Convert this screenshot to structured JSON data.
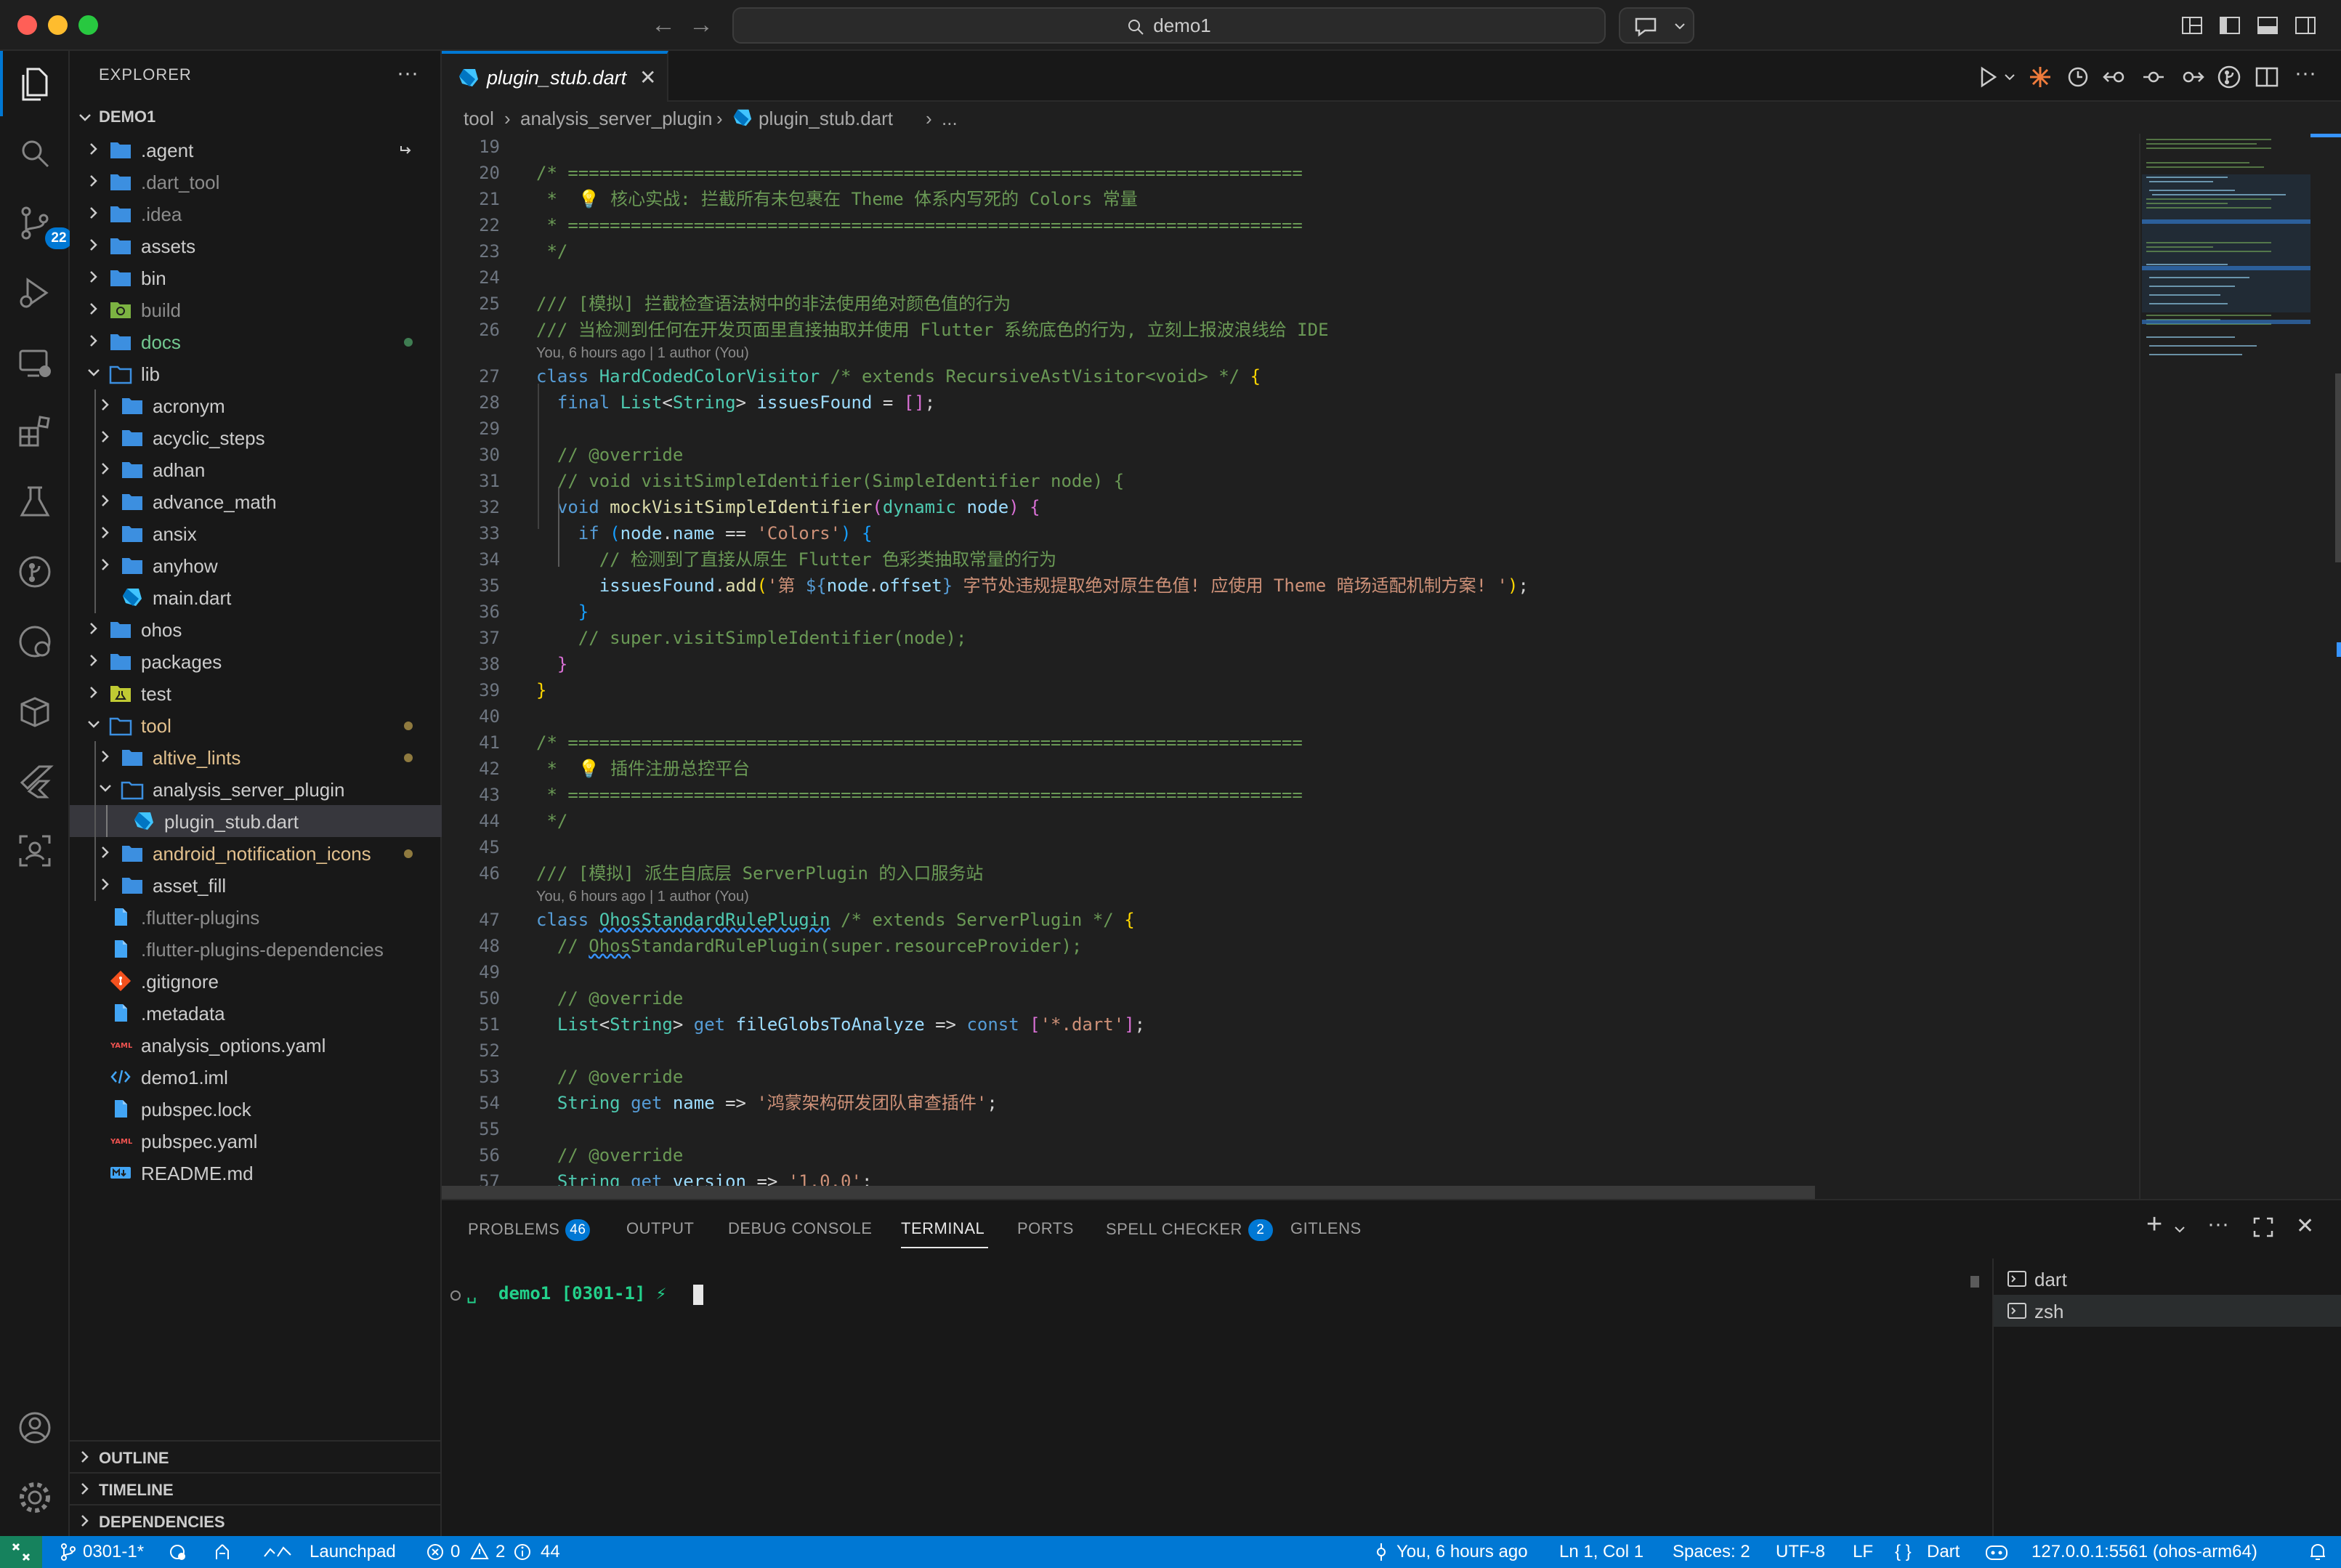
{
  "window": {
    "title": "demo1"
  },
  "sidebar": {
    "title": "EXPLORER",
    "workspace": "DEMO1",
    "tree": [
      {
        "label": ".agent",
        "depth": 0,
        "kind": "folder",
        "open": false,
        "style": "normal",
        "decor": "arrow"
      },
      {
        "label": ".dart_tool",
        "depth": 0,
        "kind": "folder",
        "open": false,
        "style": "dimmed"
      },
      {
        "label": ".idea",
        "depth": 0,
        "kind": "folder",
        "open": false,
        "style": "dimmed"
      },
      {
        "label": "assets",
        "depth": 0,
        "kind": "folder",
        "open": false,
        "style": "normal"
      },
      {
        "label": "bin",
        "depth": 0,
        "kind": "folder",
        "open": false,
        "style": "normal"
      },
      {
        "label": "build",
        "depth": 0,
        "kind": "build-folder",
        "open": false,
        "style": "dimmed"
      },
      {
        "label": "docs",
        "depth": 0,
        "kind": "folder",
        "open": false,
        "style": "green",
        "decor": "dot-green"
      },
      {
        "label": "lib",
        "depth": 0,
        "kind": "folder",
        "open": true,
        "style": "normal"
      },
      {
        "label": "acronym",
        "depth": 1,
        "kind": "folder",
        "open": false,
        "style": "normal"
      },
      {
        "label": "acyclic_steps",
        "depth": 1,
        "kind": "folder",
        "open": false,
        "style": "normal"
      },
      {
        "label": "adhan",
        "depth": 1,
        "kind": "folder",
        "open": false,
        "style": "normal"
      },
      {
        "label": "advance_math",
        "depth": 1,
        "kind": "folder",
        "open": false,
        "style": "normal"
      },
      {
        "label": "ansix",
        "depth": 1,
        "kind": "folder",
        "open": false,
        "style": "normal"
      },
      {
        "label": "anyhow",
        "depth": 1,
        "kind": "folder",
        "open": false,
        "style": "normal"
      },
      {
        "label": "main.dart",
        "depth": 1,
        "kind": "dart",
        "style": "normal"
      },
      {
        "label": "ohos",
        "depth": 0,
        "kind": "folder",
        "open": false,
        "style": "normal"
      },
      {
        "label": "packages",
        "depth": 0,
        "kind": "folder",
        "open": false,
        "style": "normal"
      },
      {
        "label": "test",
        "depth": 0,
        "kind": "test-folder",
        "open": false,
        "style": "normal"
      },
      {
        "label": "tool",
        "depth": 0,
        "kind": "folder",
        "open": true,
        "style": "modified",
        "decor": "dot-yellow"
      },
      {
        "label": "altive_lints",
        "depth": 1,
        "kind": "folder",
        "open": false,
        "style": "modified",
        "decor": "dot-yellow"
      },
      {
        "label": "analysis_server_plugin",
        "depth": 1,
        "kind": "folder",
        "open": true,
        "style": "normal"
      },
      {
        "label": "plugin_stub.dart",
        "depth": 2,
        "kind": "dart",
        "style": "normal",
        "selected": true
      },
      {
        "label": "android_notification_icons",
        "depth": 1,
        "kind": "folder",
        "open": false,
        "style": "modified",
        "decor": "dot-yellow"
      },
      {
        "label": "asset_fill",
        "depth": 1,
        "kind": "folder",
        "open": false,
        "style": "normal"
      },
      {
        "label": ".flutter-plugins",
        "depth": 0,
        "kind": "file",
        "style": "dimmed"
      },
      {
        "label": ".flutter-plugins-dependencies",
        "depth": 0,
        "kind": "file",
        "style": "dimmed"
      },
      {
        "label": ".gitignore",
        "depth": 0,
        "kind": "git",
        "style": "normal"
      },
      {
        "label": ".metadata",
        "depth": 0,
        "kind": "file",
        "style": "normal"
      },
      {
        "label": "analysis_options.yaml",
        "depth": 0,
        "kind": "yaml",
        "style": "normal"
      },
      {
        "label": "demo1.iml",
        "depth": 0,
        "kind": "xml",
        "style": "normal"
      },
      {
        "label": "pubspec.lock",
        "depth": 0,
        "kind": "file",
        "style": "normal"
      },
      {
        "label": "pubspec.yaml",
        "depth": 0,
        "kind": "yaml",
        "style": "normal"
      },
      {
        "label": "README.md",
        "depth": 0,
        "kind": "md",
        "style": "normal"
      }
    ],
    "sections": [
      "OUTLINE",
      "TIMELINE",
      "DEPENDENCIES"
    ]
  },
  "activity": {
    "scm_badge": "22"
  },
  "editor": {
    "tab_title": "plugin_stub.dart",
    "breadcrumb": [
      "tool",
      "analysis_server_plugin",
      "plugin_stub.dart",
      "..."
    ],
    "blame_text": "You, 6 hours ago | 1 author (You)",
    "lines": [
      {
        "n": "19",
        "tokens": []
      },
      {
        "n": "20",
        "tokens": [
          [
            "c-com",
            "/* ======================================================================"
          ]
        ]
      },
      {
        "n": "21",
        "tokens": [
          [
            "c-com",
            " *  💡 核心实战: 拦截所有未包裹在 Theme 体系内写死的 Colors 常量"
          ]
        ]
      },
      {
        "n": "22",
        "tokens": [
          [
            "c-com",
            " * ======================================================================"
          ]
        ]
      },
      {
        "n": "23",
        "tokens": [
          [
            "c-com",
            " */"
          ]
        ]
      },
      {
        "n": "24",
        "tokens": []
      },
      {
        "n": "25",
        "tokens": [
          [
            "c-com",
            "/// [模拟] 拦截检查语法树中的非法使用绝对颜色值的行为"
          ]
        ]
      },
      {
        "n": "26",
        "tokens": [
          [
            "c-com",
            "/// 当检测到任何在开发页面里直接抽取并使用 Flutter 系统底色的行为, 立刻上报波浪线给 IDE"
          ]
        ],
        "blame_after": true
      },
      {
        "n": "27",
        "tokens": [
          [
            "c-kw",
            "class "
          ],
          [
            "c-type",
            "HardCodedColorVisitor"
          ],
          [
            "c-com",
            " /* extends RecursiveAstVisitor<void> */"
          ],
          [
            "c-pun",
            " "
          ],
          [
            "c-br1",
            "{"
          ]
        ]
      },
      {
        "n": "28",
        "tokens": [
          [
            "c-pun",
            "  "
          ],
          [
            "c-kw",
            "final "
          ],
          [
            "c-type",
            "List"
          ],
          [
            "c-pun",
            "<"
          ],
          [
            "c-type",
            "String"
          ],
          [
            "c-pun",
            "> "
          ],
          [
            "c-var",
            "issuesFound"
          ],
          [
            "c-pun",
            " = "
          ],
          [
            "c-br2",
            "[]"
          ],
          [
            "c-pun",
            ";"
          ]
        ]
      },
      {
        "n": "29",
        "tokens": []
      },
      {
        "n": "30",
        "tokens": [
          [
            "c-com",
            "  // @override"
          ]
        ]
      },
      {
        "n": "31",
        "tokens": [
          [
            "c-com",
            "  // void visitSimpleIdentifier(SimpleIdentifier node) {"
          ]
        ]
      },
      {
        "n": "32",
        "tokens": [
          [
            "c-pun",
            "  "
          ],
          [
            "c-kw",
            "void "
          ],
          [
            "c-fn",
            "mockVisitSimpleIdentifier"
          ],
          [
            "c-br2",
            "("
          ],
          [
            "c-type",
            "dynamic "
          ],
          [
            "c-var",
            "node"
          ],
          [
            "c-br2",
            ")"
          ],
          [
            "c-pun",
            " "
          ],
          [
            "c-br2",
            "{"
          ]
        ]
      },
      {
        "n": "33",
        "tokens": [
          [
            "c-pun",
            "    "
          ],
          [
            "c-kw",
            "if "
          ],
          [
            "c-br3",
            "("
          ],
          [
            "c-var",
            "node"
          ],
          [
            "c-pun",
            "."
          ],
          [
            "c-var",
            "name"
          ],
          [
            "c-pun",
            " == "
          ],
          [
            "c-str",
            "'Colors'"
          ],
          [
            "c-br3",
            ")"
          ],
          [
            "c-pun",
            " "
          ],
          [
            "c-br3",
            "{"
          ]
        ]
      },
      {
        "n": "34",
        "tokens": [
          [
            "c-com",
            "      // 检测到了直接从原生 Flutter 色彩类抽取常量的行为"
          ]
        ]
      },
      {
        "n": "35",
        "tokens": [
          [
            "c-pun",
            "      "
          ],
          [
            "c-var",
            "issuesFound"
          ],
          [
            "c-pun",
            "."
          ],
          [
            "c-fn",
            "add"
          ],
          [
            "c-br1",
            "("
          ],
          [
            "c-str",
            "'第 "
          ],
          [
            "c-kw",
            "${"
          ],
          [
            "c-var",
            "node"
          ],
          [
            "c-pun",
            "."
          ],
          [
            "c-var",
            "offset"
          ],
          [
            "c-kw",
            "}"
          ],
          [
            "c-str",
            " 字节处违规提取绝对原生色值! 应使用 Theme 暗场适配机制方案! '"
          ],
          [
            "c-br1",
            ")"
          ],
          [
            "c-pun",
            ";"
          ]
        ]
      },
      {
        "n": "36",
        "tokens": [
          [
            "c-pun",
            "    "
          ],
          [
            "c-br3",
            "}"
          ]
        ]
      },
      {
        "n": "37",
        "tokens": [
          [
            "c-com",
            "    // super.visitSimpleIdentifier(node);"
          ]
        ]
      },
      {
        "n": "38",
        "tokens": [
          [
            "c-pun",
            "  "
          ],
          [
            "c-br2",
            "}"
          ]
        ]
      },
      {
        "n": "39",
        "tokens": [
          [
            "c-br1",
            "}"
          ]
        ]
      },
      {
        "n": "40",
        "tokens": []
      },
      {
        "n": "41",
        "tokens": [
          [
            "c-com",
            "/* ======================================================================"
          ]
        ]
      },
      {
        "n": "42",
        "tokens": [
          [
            "c-com",
            " *  💡 插件注册总控平台"
          ]
        ]
      },
      {
        "n": "43",
        "tokens": [
          [
            "c-com",
            " * ======================================================================"
          ]
        ]
      },
      {
        "n": "44",
        "tokens": [
          [
            "c-com",
            " */"
          ]
        ]
      },
      {
        "n": "45",
        "tokens": []
      },
      {
        "n": "46",
        "tokens": [
          [
            "c-com",
            "/// [模拟] 派生自底层 ServerPlugin 的入口服务站"
          ]
        ],
        "blame_after": true
      },
      {
        "n": "47",
        "tokens": [
          [
            "c-kw",
            "class "
          ],
          [
            "c-type squiggle",
            "OhosStandardRulePlugin"
          ],
          [
            "c-com",
            " /* extends ServerPlugin */"
          ],
          [
            "c-pun",
            " "
          ],
          [
            "c-br1",
            "{"
          ]
        ]
      },
      {
        "n": "48",
        "tokens": [
          [
            "c-com",
            "  // "
          ],
          [
            "c-com squiggle",
            "Ohos"
          ],
          [
            "c-com",
            "StandardRulePlugin(super.resourceProvider);"
          ]
        ]
      },
      {
        "n": "49",
        "tokens": []
      },
      {
        "n": "50",
        "tokens": [
          [
            "c-com",
            "  // @override"
          ]
        ]
      },
      {
        "n": "51",
        "tokens": [
          [
            "c-pun",
            "  "
          ],
          [
            "c-type",
            "List"
          ],
          [
            "c-pun",
            "<"
          ],
          [
            "c-type",
            "String"
          ],
          [
            "c-pun",
            "> "
          ],
          [
            "c-kw",
            "get "
          ],
          [
            "c-var",
            "fileGlobsToAnalyze"
          ],
          [
            "c-pun",
            " => "
          ],
          [
            "c-kw",
            "const "
          ],
          [
            "c-br2",
            "["
          ],
          [
            "c-str",
            "'*.dart'"
          ],
          [
            "c-br2",
            "]"
          ],
          [
            "c-pun",
            ";"
          ]
        ]
      },
      {
        "n": "52",
        "tokens": []
      },
      {
        "n": "53",
        "tokens": [
          [
            "c-com",
            "  // @override"
          ]
        ]
      },
      {
        "n": "54",
        "tokens": [
          [
            "c-pun",
            "  "
          ],
          [
            "c-type",
            "String "
          ],
          [
            "c-kw",
            "get "
          ],
          [
            "c-var",
            "name"
          ],
          [
            "c-pun",
            " => "
          ],
          [
            "c-str",
            "'鸿蒙架构研发团队审查插件'"
          ],
          [
            "c-pun",
            ";"
          ]
        ]
      },
      {
        "n": "55",
        "tokens": []
      },
      {
        "n": "56",
        "tokens": [
          [
            "c-com",
            "  // @override"
          ]
        ]
      },
      {
        "n": "57",
        "tokens": [
          [
            "c-pun",
            "  "
          ],
          [
            "c-type",
            "String "
          ],
          [
            "c-kw",
            "get "
          ],
          [
            "c-var",
            "version"
          ],
          [
            "c-pun",
            " => "
          ],
          [
            "c-str",
            "'1.0.0'"
          ],
          [
            "c-pun",
            ";"
          ]
        ]
      }
    ]
  },
  "panel": {
    "tabs": [
      {
        "label": "PROBLEMS",
        "badge": "46"
      },
      {
        "label": "OUTPUT",
        "badge": null
      },
      {
        "label": "DEBUG CONSOLE",
        "badge": null
      },
      {
        "label": "TERMINAL",
        "badge": null,
        "active": true
      },
      {
        "label": "PORTS",
        "badge": null
      },
      {
        "label": "SPELL CHECKER",
        "badge": "2"
      },
      {
        "label": "GITLENS",
        "badge": null
      }
    ],
    "terminal_prompt": "demo1 [0301-1] ⚡",
    "terminals": [
      "dart",
      "zsh"
    ]
  },
  "statusbar": {
    "branch": "0301-1*",
    "launchpad": "Launchpad",
    "errors": "0",
    "warnings": "2",
    "infos": "44",
    "blame": "You, 6 hours ago",
    "position": "Ln 1, Col 1",
    "spaces": "Spaces: 2",
    "encoding": "UTF-8",
    "eol": "LF",
    "language": "Dart",
    "device": "127.0.0.1:5561 (ohos-arm64)"
  },
  "colors": {
    "accent": "#0078d4",
    "remote": "#16825d",
    "folder": "#3c8fe0",
    "modified": "#e2c08d",
    "git_green": "#73c991"
  }
}
